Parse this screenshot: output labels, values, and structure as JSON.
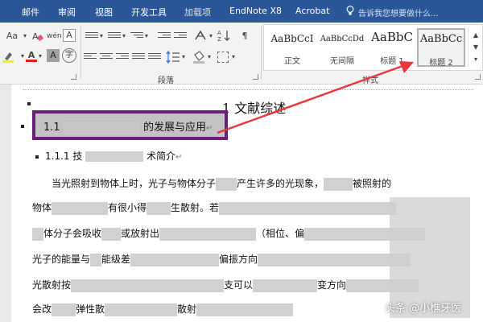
{
  "tabs": [
    {
      "label": "邮件"
    },
    {
      "label": "审阅"
    },
    {
      "label": "视图"
    },
    {
      "label": "开发工具"
    },
    {
      "label": "加载项"
    },
    {
      "label": "EndNote X8"
    },
    {
      "label": "Acrobat"
    }
  ],
  "tell_me": "告诉我您想要做什么...",
  "ribbon": {
    "font_group": {
      "case_label": "Aa",
      "phonetic_label": "wén",
      "border_char_label": "A",
      "font_color_label": "A",
      "char_shade_label": "A",
      "enclose_label": "字"
    },
    "paragraph_group_label": "段落",
    "styles_group_label": "样式",
    "styles": [
      {
        "preview": "AaBbCcI",
        "name": "正文"
      },
      {
        "preview": "AaBbCcDd",
        "name": "无间隔"
      },
      {
        "preview": "AaBbC",
        "name": "标题 1"
      },
      {
        "preview": "AaBbCc",
        "name": "标题 2"
      }
    ]
  },
  "document": {
    "heading1": "1 文献综述",
    "heading2_prefix": "1.1",
    "heading2_suffix": "的发展与应用",
    "heading3_prefix": "1.1.1 技",
    "heading3_suffix": "术简介",
    "para_lines": [
      {
        "a": "当光照射到物体上时，光子与物体分子",
        "b": "产生许多的光现象，",
        "c": "被照射的"
      },
      {
        "a": "物体",
        "b": "有很小得",
        "c": "生散射。若"
      },
      {
        "a": "体分子会吸收",
        "b": "或放射出",
        "c": "（相位、偏"
      },
      {
        "a": "光子的能量与",
        "b": "能级差",
        "c": "偏振方向"
      },
      {
        "a": "光散射按",
        "b": "支可以",
        "c": "变方向"
      },
      {
        "a": "会改",
        "b": "弹性散",
        "c": "散射"
      }
    ]
  },
  "watermark": "头条 @小樵牙医",
  "colors": {
    "tab_bar": "#2b579a",
    "highlight_border": "#6b1f7a",
    "arrow": "#e8383d"
  }
}
